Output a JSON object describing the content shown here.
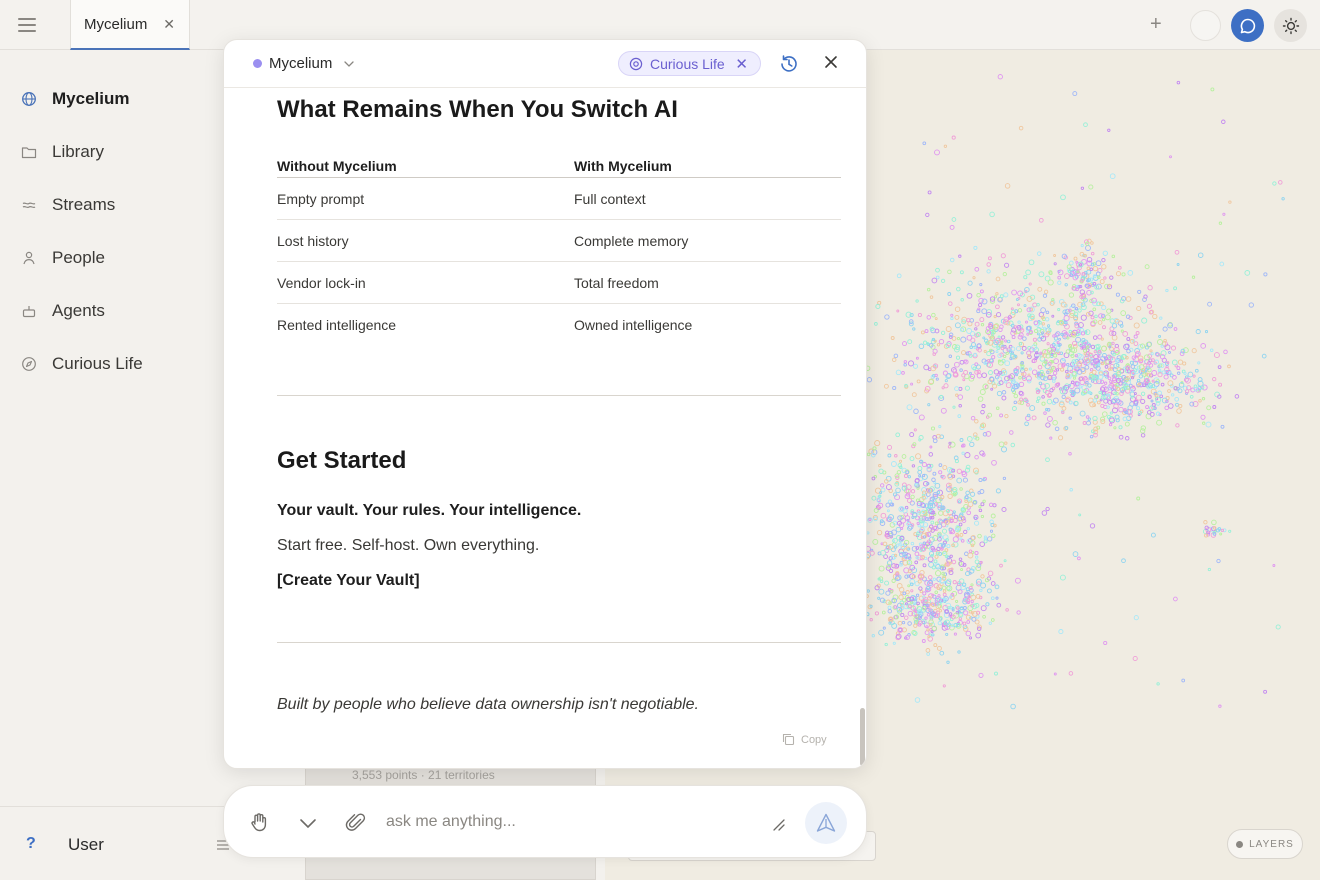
{
  "tabs": [
    {
      "label": "Mycelium",
      "close": "✕"
    }
  ],
  "topbar": {
    "plus": "+"
  },
  "sidebar": {
    "items": [
      {
        "label": "Mycelium",
        "icon": "globe-icon"
      },
      {
        "label": "Library",
        "icon": "folder-icon"
      },
      {
        "label": "Streams",
        "icon": "waves-icon"
      },
      {
        "label": "People",
        "icon": "person-icon"
      },
      {
        "label": "Agents",
        "icon": "agent-icon"
      },
      {
        "label": "Curious Life",
        "icon": "compass-icon"
      }
    ],
    "footer": {
      "help": "?",
      "user": "User"
    }
  },
  "dialog": {
    "workspace": "Mycelium",
    "context_pill": {
      "label": "Curious Life",
      "close": "✕"
    },
    "section1": {
      "title": "What Remains When You Switch AI",
      "columns": [
        "Without Mycelium",
        "With Mycelium"
      ],
      "rows": [
        [
          "Empty prompt",
          "Full context"
        ],
        [
          "Lost history",
          "Complete memory"
        ],
        [
          "Vendor lock-in",
          "Total freedom"
        ],
        [
          "Rented intelligence",
          "Owned intelligence"
        ]
      ]
    },
    "section2": {
      "title": "Get Started",
      "tagline": "Your vault. Your rules. Your intelligence.",
      "body": "Start free. Self-host. Own everything.",
      "cta": "[Create Your Vault]"
    },
    "footer_note": "Built by people who believe data ownership isn't negotiable.",
    "copy_label": "Copy"
  },
  "background_panel": {
    "stats": "3,553 points · 21 territories"
  },
  "chat_input": {
    "placeholder": "ask me anything..."
  },
  "map": {
    "layers_label": "LAYERS"
  },
  "colors": {
    "accent": "#3d6fc4",
    "context": "#6a5fd0",
    "workspace_dot": "#9b8ff0"
  }
}
